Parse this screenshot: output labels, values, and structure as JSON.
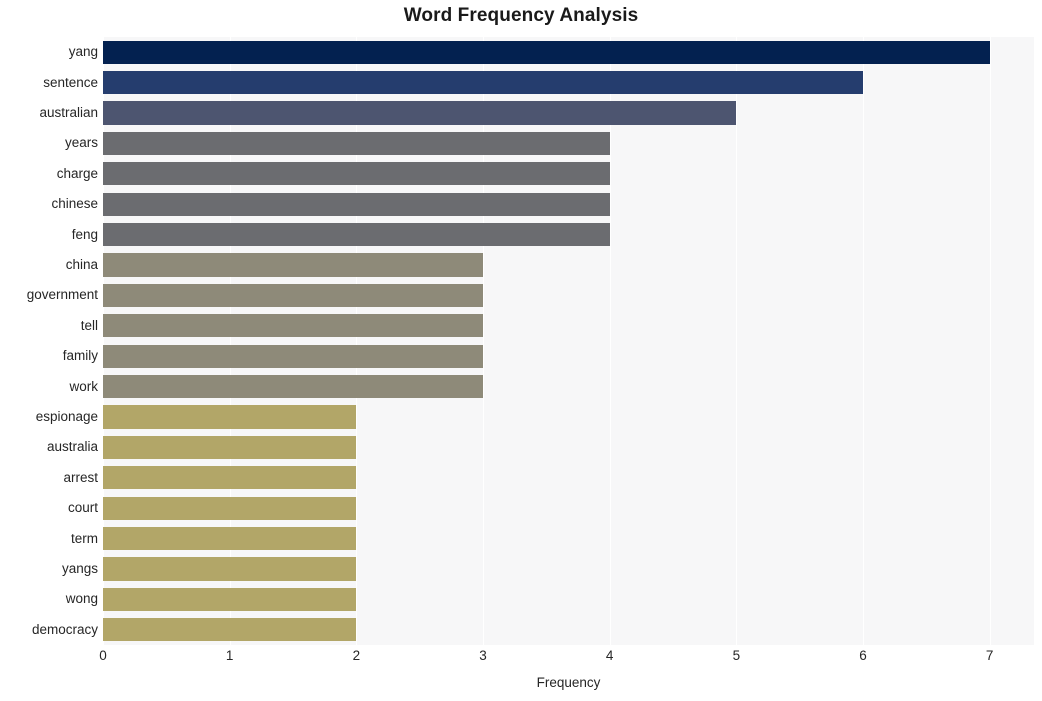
{
  "chart_data": {
    "type": "bar",
    "orientation": "horizontal",
    "title": "Word Frequency Analysis",
    "xlabel": "Frequency",
    "ylabel": "",
    "xlim": [
      0,
      7.35
    ],
    "xticks": [
      0,
      1,
      2,
      3,
      4,
      5,
      6,
      7
    ],
    "xtick_labels": [
      "0",
      "1",
      "2",
      "3",
      "4",
      "5",
      "6",
      "7"
    ],
    "grid": "vertical-only",
    "legend": "none",
    "categories": [
      "yang",
      "sentence",
      "australian",
      "years",
      "charge",
      "chinese",
      "feng",
      "china",
      "government",
      "tell",
      "family",
      "work",
      "espionage",
      "australia",
      "arrest",
      "court",
      "term",
      "yangs",
      "wong",
      "democracy"
    ],
    "values": [
      7,
      6,
      5,
      4,
      4,
      4,
      4,
      3,
      3,
      3,
      3,
      3,
      2,
      2,
      2,
      2,
      2,
      2,
      2,
      2
    ],
    "bar_colors": [
      "#032150",
      "#253d6e",
      "#4d5570",
      "#6b6c70",
      "#6b6c70",
      "#6b6c70",
      "#6b6c70",
      "#8e8a79",
      "#8e8a79",
      "#8e8a79",
      "#8e8a79",
      "#8e8a79",
      "#b2a668",
      "#b2a668",
      "#b2a668",
      "#b2a668",
      "#b2a668",
      "#b2a668",
      "#b2a668",
      "#b2a668"
    ]
  },
  "style": {
    "plot_background": "#f7f7f8",
    "figure_background": "#ffffff",
    "gridline_color": "#ffffff",
    "text_color": "#262626",
    "title_color": "#1a1a1a"
  }
}
